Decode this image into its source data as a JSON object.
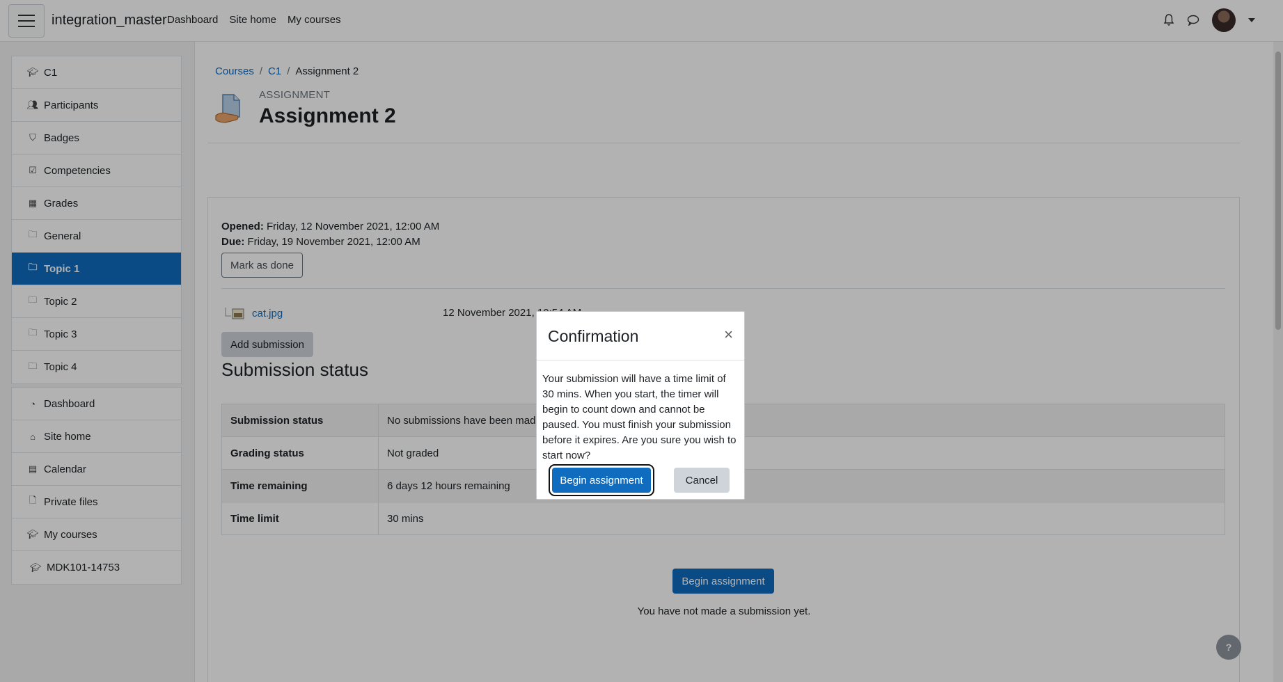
{
  "navbar": {
    "brand": "integration_master",
    "links": [
      "Dashboard",
      "Site home",
      "My courses"
    ]
  },
  "drawer": {
    "course_items": [
      {
        "label": "C1",
        "icon": "graduation-cap-icon"
      },
      {
        "label": "Participants",
        "icon": "users-icon"
      },
      {
        "label": "Badges",
        "icon": "shield-icon"
      },
      {
        "label": "Competencies",
        "icon": "check-square-icon"
      },
      {
        "label": "Grades",
        "icon": "table-icon"
      },
      {
        "label": "General",
        "icon": "folder-icon"
      },
      {
        "label": "Topic 1",
        "icon": "folder-icon",
        "active": true
      },
      {
        "label": "Topic 2",
        "icon": "folder-icon"
      },
      {
        "label": "Topic 3",
        "icon": "folder-icon"
      },
      {
        "label": "Topic 4",
        "icon": "folder-icon"
      }
    ],
    "site_items": [
      {
        "label": "Dashboard",
        "icon": "dashboard-icon"
      },
      {
        "label": "Site home",
        "icon": "home-icon"
      },
      {
        "label": "Calendar",
        "icon": "calendar-icon"
      },
      {
        "label": "Private files",
        "icon": "file-icon"
      },
      {
        "label": "My courses",
        "icon": "graduation-cap-icon"
      },
      {
        "label": "MDK101-14753",
        "icon": "graduation-cap-icon"
      }
    ]
  },
  "breadcrumb": {
    "items": [
      "Courses",
      "C1",
      "Assignment 2"
    ],
    "separator": "/"
  },
  "activity": {
    "type_label": "ASSIGNMENT",
    "title": "Assignment 2"
  },
  "dates": {
    "opened_label": "Opened:",
    "opened_value": "Friday, 12 November 2021, 12:00 AM",
    "due_label": "Due:",
    "due_value": "Friday, 19 November 2021, 12:00 AM"
  },
  "mark_done_label": "Mark as done",
  "attachment": {
    "name": "cat.jpg",
    "date": "12 November 2021, 10:54 AM"
  },
  "add_submission_label": "Add submission",
  "submission_heading": "Submission status",
  "status_table": [
    {
      "label": "Submission status",
      "value": "No submissions have been made yet"
    },
    {
      "label": "Grading status",
      "value": "Not graded"
    },
    {
      "label": "Time remaining",
      "value": "6 days 12 hours remaining"
    },
    {
      "label": "Time limit",
      "value": "30 mins"
    }
  ],
  "begin_button_label": "Begin assignment",
  "no_submission_text": "You have not made a submission yet.",
  "help_label": "?",
  "modal": {
    "title": "Confirmation",
    "close_glyph": "×",
    "body": "Your submission will have a time limit of 30 mins. When you start, the timer will begin to count down and cannot be paused. You must finish your submission before it expires. Are you sure you wish to start now?",
    "confirm_label": "Begin assignment",
    "cancel_label": "Cancel"
  },
  "colors": {
    "primary": "#0f6cbf",
    "secondary": "#ced4da"
  }
}
